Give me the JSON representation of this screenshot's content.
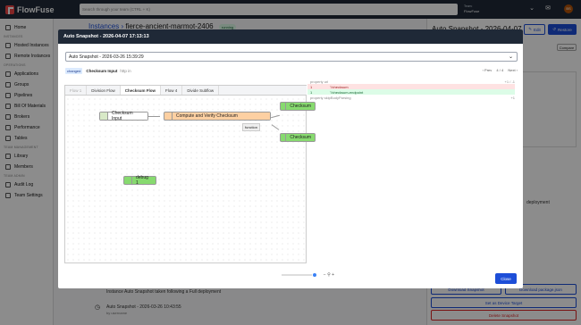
{
  "brand": {
    "name": "FlowFuse"
  },
  "header": {
    "search_placeholder": "Search through your team (CTRL + K)",
    "team_label": "Team:",
    "team_name": "FlowFuse",
    "avatar_initials": "BS"
  },
  "sidebar": {
    "home": "Home",
    "section_instances": "INSTANCES",
    "hosted": "Hosted Instances",
    "remote": "Remote Instances",
    "section_ops": "OPERATIONS",
    "items": [
      "Applications",
      "Groups",
      "Pipelines",
      "Bill Of Materials",
      "Brokers",
      "Performance",
      "Tables"
    ],
    "section_team": "TEAM MANAGEMENT",
    "team_items": [
      "Library",
      "Members"
    ],
    "section_admin": "TEAM ADMIN",
    "admin_items": [
      "Audit Log",
      "Team Settings"
    ]
  },
  "breadcrumb": {
    "parent": "Instances",
    "current": "fierce-ancient-marmot-2406",
    "status": "running"
  },
  "right_panel": {
    "title": "Auto Snapshot - 2026-04-07",
    "edit": "Edit",
    "restore": "Restore",
    "compare": "Compare",
    "deployment_text": "deployment",
    "btn_download_snapshot": "Download Snapshot",
    "btn_download_package": "Download package.json",
    "btn_set_target": "Set as Device Target",
    "btn_delete": "Delete Snapshot"
  },
  "background_list": {
    "row1_desc": "Instance Auto Snapshot taken following a Full deployment",
    "row2_title": "Auto Snapshot - 2026-03-26 10:43:55",
    "row2_sub": "by username"
  },
  "modal": {
    "title": "Auto Snapshot - 2026-04-07 17:13:13",
    "compare_with": "Auto Snapshot - 2026-03-26 15:39:29",
    "changed_badge": "changed",
    "changed_node": "Checksum Input",
    "changed_type": "http in",
    "pager_prev": "‹ Prev",
    "pager_count": "4 / 4",
    "pager_next": "Next ›",
    "tabs": [
      "Flow 1",
      "Division Flow",
      "Checksum Flow",
      "Flow 4",
      "Divide Subflow"
    ],
    "nodes": {
      "checksum_input": "Checksum Input",
      "compute": "Compute and Verify Checksum",
      "function_tip": "function",
      "checksum_right": "Checksum",
      "checksum_right2": "Checksum",
      "debug": "debug 1"
    },
    "json": {
      "prop_url": "property url",
      "line_a": "1",
      "old_val": "\"/checksum",
      "new_val": "\"/checksum-endpoint",
      "prop_skip": "property skipBodyParsing",
      "counter1": "+1 / -1",
      "counter2": "+1"
    },
    "close": "Close"
  }
}
